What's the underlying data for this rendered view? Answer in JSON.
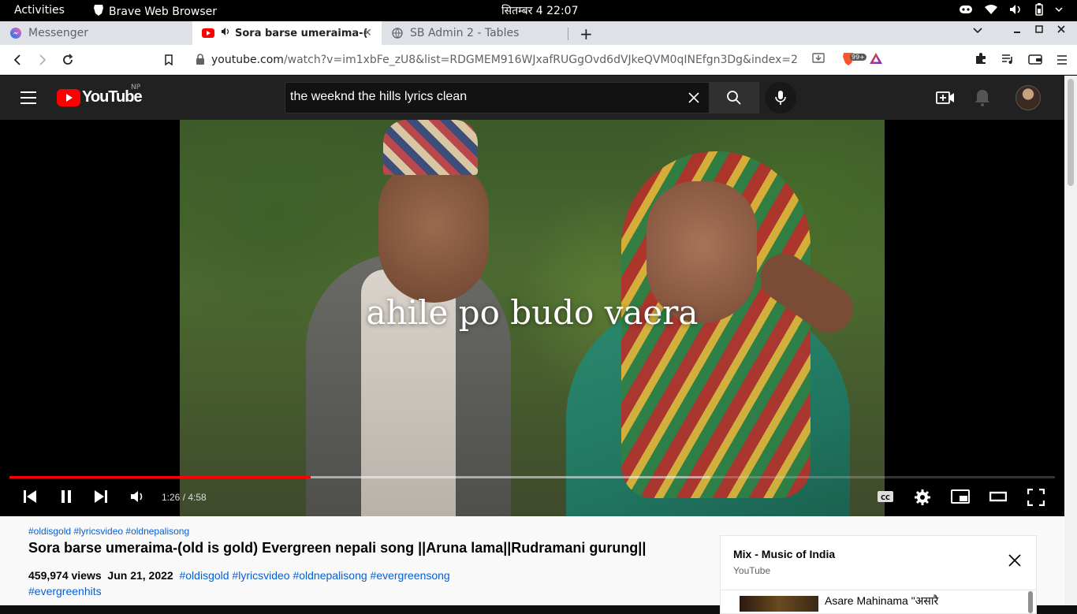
{
  "system": {
    "activities": "Activities",
    "app_name": "Brave Web Browser",
    "clock": "सितम्बर 4  22:07"
  },
  "tabs": [
    {
      "label": "Messenger",
      "active": false
    },
    {
      "label": "Sora barse umeraima-(o",
      "active": true
    },
    {
      "label": "SB Admin 2 - Tables",
      "active": false
    }
  ],
  "address": {
    "host": "youtube.com",
    "path": "/watch?v=im1xbFe_zU8&list=RDGMEM916WJxafRUGgOvd6dVJkeQVM0qINEfgn3Dg&index=2",
    "shield_badge": "99+"
  },
  "youtube": {
    "logo_text": "YouTube",
    "region": "NP",
    "search_value": "the weeknd the hills lyrics clean",
    "search_placeholder": "Search"
  },
  "player": {
    "caption": "ahile po budo vaera",
    "time": "1:26 / 4:58",
    "progress": 0.288,
    "buffered": 0.67
  },
  "video": {
    "hashtags_top": "#oldisgold #lyricsvideo #oldnepalisong",
    "title": "Sora barse umeraima-(old is gold) Evergreen nepali song ||Aruna lama||Rudramani gurung||",
    "views": "459,974 views",
    "date": "Jun 21, 2022",
    "tags_line": "#oldisgold #lyricsvideo #oldnepalisong #evergreensong",
    "tags_line2": "#evergreenhits"
  },
  "mix": {
    "title": "Mix - Music of India",
    "subtitle": "YouTube",
    "first_item": "Asare Mahinama \"असारै"
  },
  "colors": {
    "accent_red": "#ff0000",
    "link_blue": "#065fd4"
  }
}
